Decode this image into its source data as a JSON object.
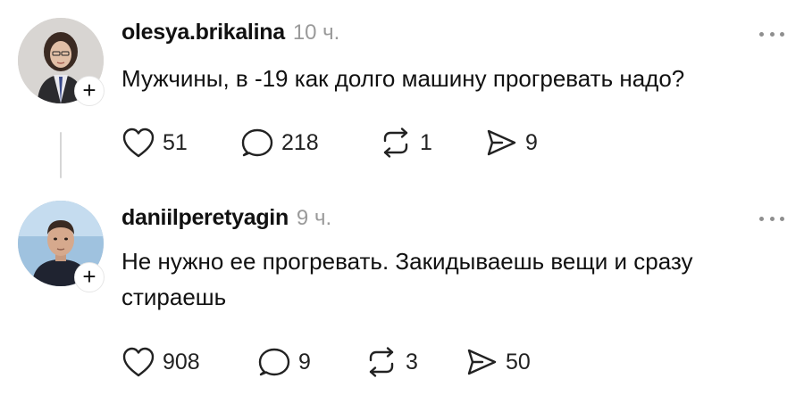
{
  "posts": [
    {
      "username": "olesya.brikalina",
      "time": "10 ч.",
      "text": "Мужчины, в -19 как долго машину прогревать надо?",
      "follow_symbol": "+",
      "likes": "51",
      "comments": "218",
      "reposts": "1",
      "shares": "9"
    },
    {
      "username": "daniilperetyagin",
      "time": "9 ч.",
      "text": "Не нужно ее прогревать. Закидываешь вещи и сразу стираешь",
      "follow_symbol": "+",
      "likes": "908",
      "comments": "9",
      "reposts": "3",
      "shares": "50"
    }
  ],
  "icons": {
    "like": "heart-icon",
    "comment": "comment-bubble-icon",
    "repost": "repost-icon",
    "share": "send-icon",
    "more": "more-options-icon"
  }
}
